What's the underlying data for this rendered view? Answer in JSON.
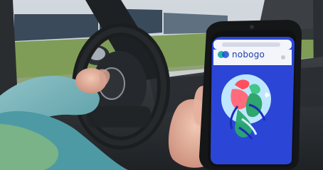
{
  "image": {
    "description_tag": "driver-holding-smartphone-with-app"
  },
  "app": {
    "brand_name": "nobogo",
    "colors": {
      "screen_blue": "#2b46d6",
      "header_white": "#f3f5fb",
      "logo_teal": "#24b6a3",
      "logo_blue": "#1c4fd8",
      "illustration_circle": "#bfe6ff"
    }
  }
}
